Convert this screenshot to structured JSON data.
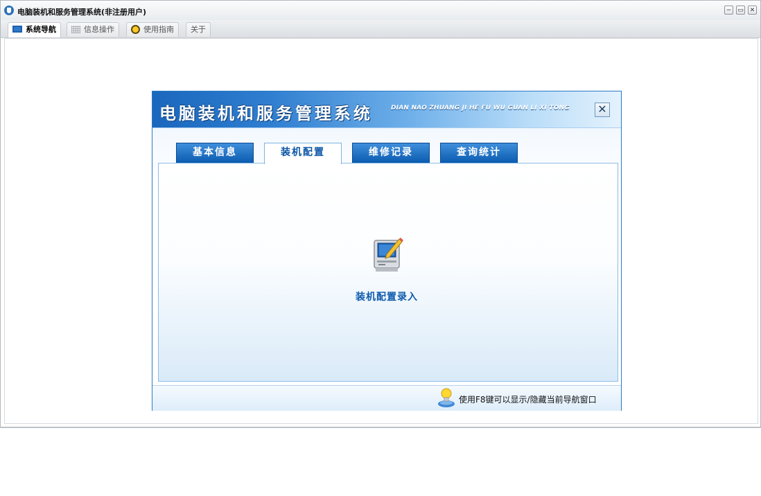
{
  "window": {
    "title": "电脑装机和服务管理系统(非注册用户)",
    "controls": {
      "minimize": "−",
      "maximize": "▭",
      "close": "✕"
    }
  },
  "main_tabs": [
    {
      "label": "系统导航",
      "icon": "monitor-icon",
      "active": true
    },
    {
      "label": "信息操作",
      "icon": "grid-icon",
      "active": false
    },
    {
      "label": "使用指南",
      "icon": "bulb-icon",
      "active": false
    },
    {
      "label": "关于",
      "icon": null,
      "active": false
    }
  ],
  "dialog": {
    "title": "电脑装机和服务管理系统",
    "subtitle": "DIAN NAO ZHUANG JI HE FU WU GUAN LI XI TONG",
    "close_label": "✕",
    "tabs": [
      {
        "label": "基本信息",
        "active": false
      },
      {
        "label": "装机配置",
        "active": true
      },
      {
        "label": "维修记录",
        "active": false
      },
      {
        "label": "查询统计",
        "active": false
      }
    ],
    "entry": {
      "label": "装机配置录入",
      "icon": "computer-edit-icon"
    },
    "footer_hint": "使用F8键可以显示/隐藏当前导航窗口"
  },
  "colors": {
    "accent": "#1a67bd",
    "tab_blue": "#0b5bb0",
    "label_blue": "#0d5bae"
  }
}
